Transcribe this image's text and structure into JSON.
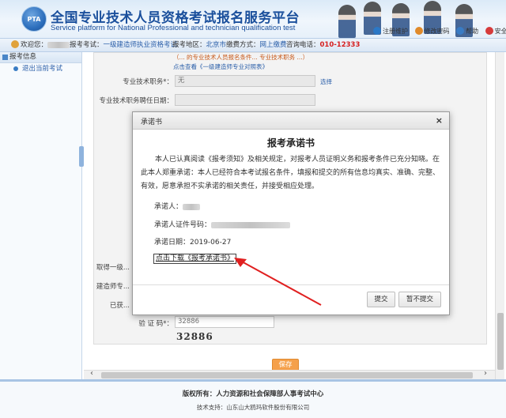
{
  "header": {
    "logo_text": "PTA",
    "title": "全国专业技术人员资格考试报名服务平台",
    "subtitle": "Service platform for National Professional and technician qualification test",
    "links": [
      {
        "label": "注册维护",
        "color": "#2b78c6"
      },
      {
        "label": "修改密码",
        "color": "#e08a2a"
      },
      {
        "label": "帮助",
        "color": "#3a7cc4"
      },
      {
        "label": "安全退出",
        "color": "#d63b3b"
      }
    ]
  },
  "infobar": {
    "welcome_label": "欢迎您：",
    "exam_label": "报考考试：",
    "exam_value": "一级建造师执业资格考试",
    "region_label": "报考地区：",
    "region_value": "北京市",
    "pay_label": "缴费方式：",
    "pay_value": "网上缴费",
    "phone_label": "咨询电话：",
    "phone_value": "010-12333"
  },
  "sidebar": {
    "header": "报考信息",
    "items": [
      {
        "label": "退出当前考试"
      }
    ]
  },
  "form": {
    "note_top": "（... 的专业技术人员报名条件... 专业技术职务 ...）",
    "link_top": "点击查看《一级建造师专业对照表》",
    "title_label": "专业技术职务*：",
    "title_value": "无",
    "title_link": "选择",
    "hire_date_label": "专业技术职务聘任日期：",
    "obtain_label": "取得一级...",
    "builder_label": "建造师专...",
    "already_label": "已获...",
    "captcha_label": "验 证 码*：",
    "captcha_input": "32886",
    "captcha_image_text": "32886",
    "save_label": "保存"
  },
  "modal": {
    "title": "承诺书",
    "close": "×",
    "heading": "报考承诺书",
    "paragraph": "本人已认真阅读《报考须知》及相关规定，对报考人员证明义务和报考条件已充分知晓。在此本人郑重承诺：本人已经符合本考试报名条件，填报和提交的所有信息均真实、准确、完整、有效，愿意承担不实承诺的相关责任，并接受相应处理。",
    "pledger_label": "承诺人：",
    "id_label": "承诺人证件号码：",
    "date_label": "承诺日期：",
    "date_value": "2019-06-27",
    "download_link": "点击下载《报考承诺书》",
    "submit_label": "提交",
    "no_submit_label": "暂不提交"
  },
  "footer": {
    "copyright": "版权所有：人力资源和社会保障部人事考试中心",
    "support": "技术支持：山东山大鸥玛软件股份有限公司"
  },
  "colors": {
    "brand_blue": "#1a4f9c",
    "link_blue": "#2b5fa9",
    "phone_red": "#d61f1f",
    "save_orange": "#f5a04a",
    "arrow_red": "#e02020"
  }
}
